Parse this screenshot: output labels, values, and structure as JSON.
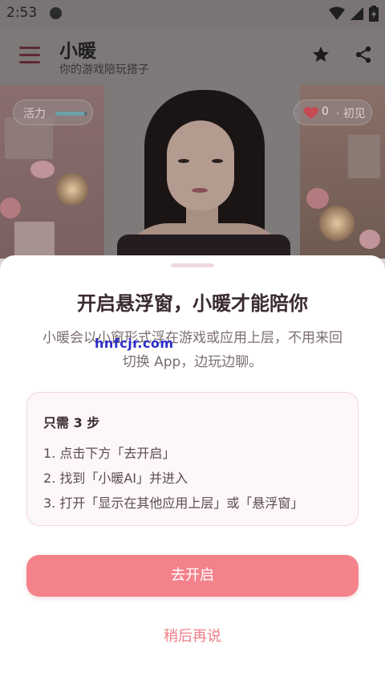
{
  "status_bar": {
    "time": "2:53",
    "icons": [
      "record-dot-icon",
      "wifi-icon",
      "signal-icon",
      "battery-icon"
    ]
  },
  "app_bar": {
    "title": "小暖",
    "subtitle": "你的游戏陪玩搭子",
    "actions": [
      "star-icon",
      "share-icon"
    ]
  },
  "hero": {
    "energy_label": "活力",
    "energy_fraction": 0.9,
    "affinity_value": "0",
    "affinity_level": "· 初见"
  },
  "sheet": {
    "title": "开启悬浮窗，小暖才能陪你",
    "description_line1": "小暖会以小窗形式浮在游戏或应用上层，不用来回",
    "description_line2": "切换 App，边玩边聊。",
    "steps_title": "只需 3 步",
    "steps": [
      "1. 点击下方「去开启」",
      "2. 找到「小暖AI」并进入",
      "3. 打开「显示在其他应用上层」或「悬浮窗」"
    ],
    "primary_button": "去开启",
    "later_button": "稍后再说"
  },
  "watermark": "hnfcjr.com",
  "colors": {
    "accent": "#f4828b",
    "link": "#ef7e88",
    "card_border": "#f1d5da"
  }
}
